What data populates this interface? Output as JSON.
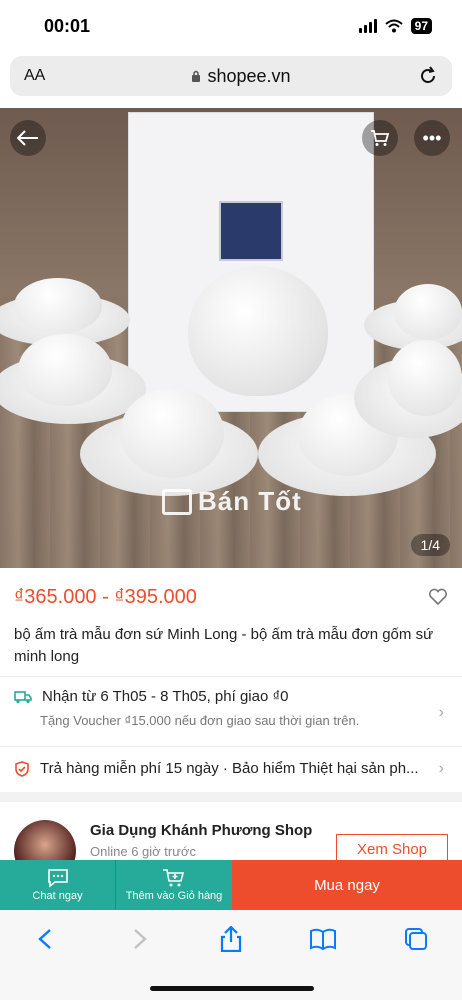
{
  "status_bar": {
    "time": "00:01",
    "battery": "97"
  },
  "browser": {
    "text_size": "AA",
    "url": "shopee.vn"
  },
  "product": {
    "image_counter": "1/4",
    "watermark": "Bán Tốt",
    "price": "₫365.000 - ₫395.000",
    "title": "bộ ấm trà mẫu đơn sứ Minh Long - bộ ấm trà mẫu đơn gốm sứ minh long"
  },
  "shipping": {
    "line1": "Nhận từ 6 Th05 - 8 Th05, phí giao ₫0",
    "line2": "Tặng Voucher ₫15.000 nếu đơn giao sau thời gian trên."
  },
  "return_policy": "Trả hàng miễn phí 15 ngày · Bảo hiểm Thiệt hại sản ph...",
  "shop": {
    "name": "Gia Dụng Khánh Phương Shop",
    "status": "Online 6 giờ trước",
    "button": "Xem Shop"
  },
  "actions": {
    "chat": "Chat ngay",
    "add_cart": "Thêm vào Giỏ hàng",
    "buy": "Mua ngay"
  },
  "colors": {
    "shopee_orange": "#ee4d2d",
    "teal": "#26aa99",
    "ios_blue": "#0a7aff"
  }
}
